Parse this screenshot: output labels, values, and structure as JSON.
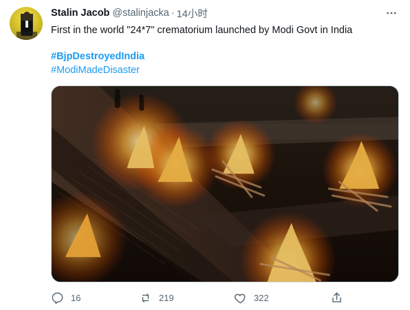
{
  "tweet": {
    "author": {
      "name": "Stalin Jacob",
      "handle": "@stalinjacka",
      "separator": "·",
      "time": "14小时"
    },
    "text": "First in the world \"24*7\" crematorium launched by Modi Govt in India",
    "hashtags": [
      "#BjpDestroyedIndia",
      "#ModiMadeDisaster"
    ],
    "media": {
      "description_icon": "photo-icon"
    },
    "actions": {
      "reply_count": "16",
      "retweet_count": "219",
      "like_count": "322"
    }
  },
  "colors": {
    "link": "#1d9bf0",
    "secondary_text": "#536471",
    "primary_text": "#0f1419",
    "border": "#cfd9de"
  },
  "icons": {
    "more": "more-icon",
    "reply": "reply-icon",
    "retweet": "retweet-icon",
    "like": "heart-icon",
    "share": "share-icon"
  }
}
